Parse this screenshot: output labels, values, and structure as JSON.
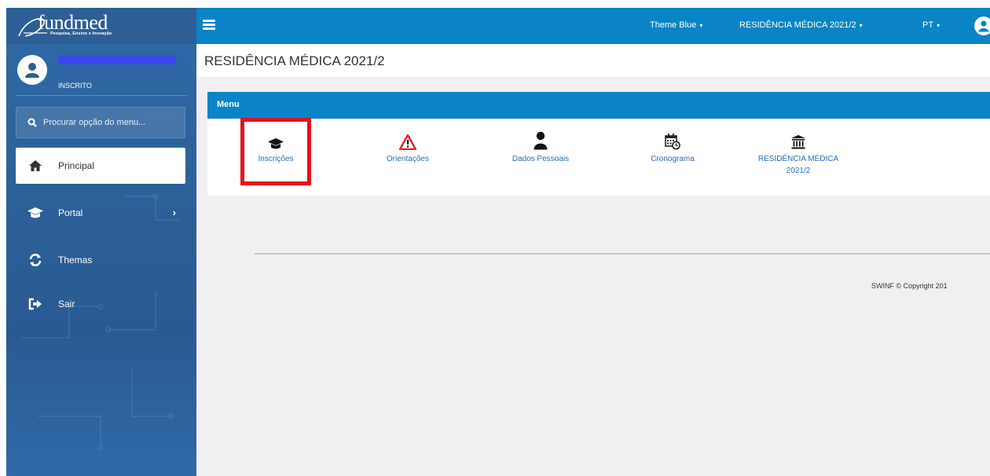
{
  "brand": {
    "logo_text": "fundmed",
    "logo_sub": "Pesquisa, Ensino e Inovação"
  },
  "user": {
    "role": "INSCRITO"
  },
  "sidebar": {
    "search_placeholder": "Procurar opção do menu...",
    "items": [
      {
        "label": "Principal",
        "icon": "home-icon",
        "active": true
      },
      {
        "label": "Portal",
        "icon": "graduation-cap-icon",
        "has_submenu": true
      },
      {
        "label": "Themas",
        "icon": "refresh-icon"
      },
      {
        "label": "Sair",
        "icon": "sign-out-icon"
      }
    ]
  },
  "topbar": {
    "theme": "Theme Blue",
    "program": "RESIDÊNCIA MÉDICA 2021/2",
    "language": "PT",
    "caret": "▾"
  },
  "page": {
    "title": "RESIDÊNCIA MÉDICA 2021/2"
  },
  "menu_panel": {
    "heading": "Menu",
    "items": [
      {
        "label": "Inscrições",
        "icon": "graduation-cap-icon",
        "highlighted": true
      },
      {
        "label": "Orientações",
        "icon": "warning-icon"
      },
      {
        "label": "Dados Pessoais",
        "icon": "user-icon"
      },
      {
        "label": "Cronograma",
        "icon": "calendar-clock-icon"
      },
      {
        "label": "RESIDÊNCIA MÉDICA 2021/2",
        "icon": "institution-icon"
      }
    ]
  },
  "footer": {
    "copyright": "SWINF © Copyright 201"
  },
  "colors": {
    "topbar": "#0a84c6",
    "sidebar": "#2c5f97",
    "highlight": "#e3111c",
    "link": "#2a6db0"
  }
}
